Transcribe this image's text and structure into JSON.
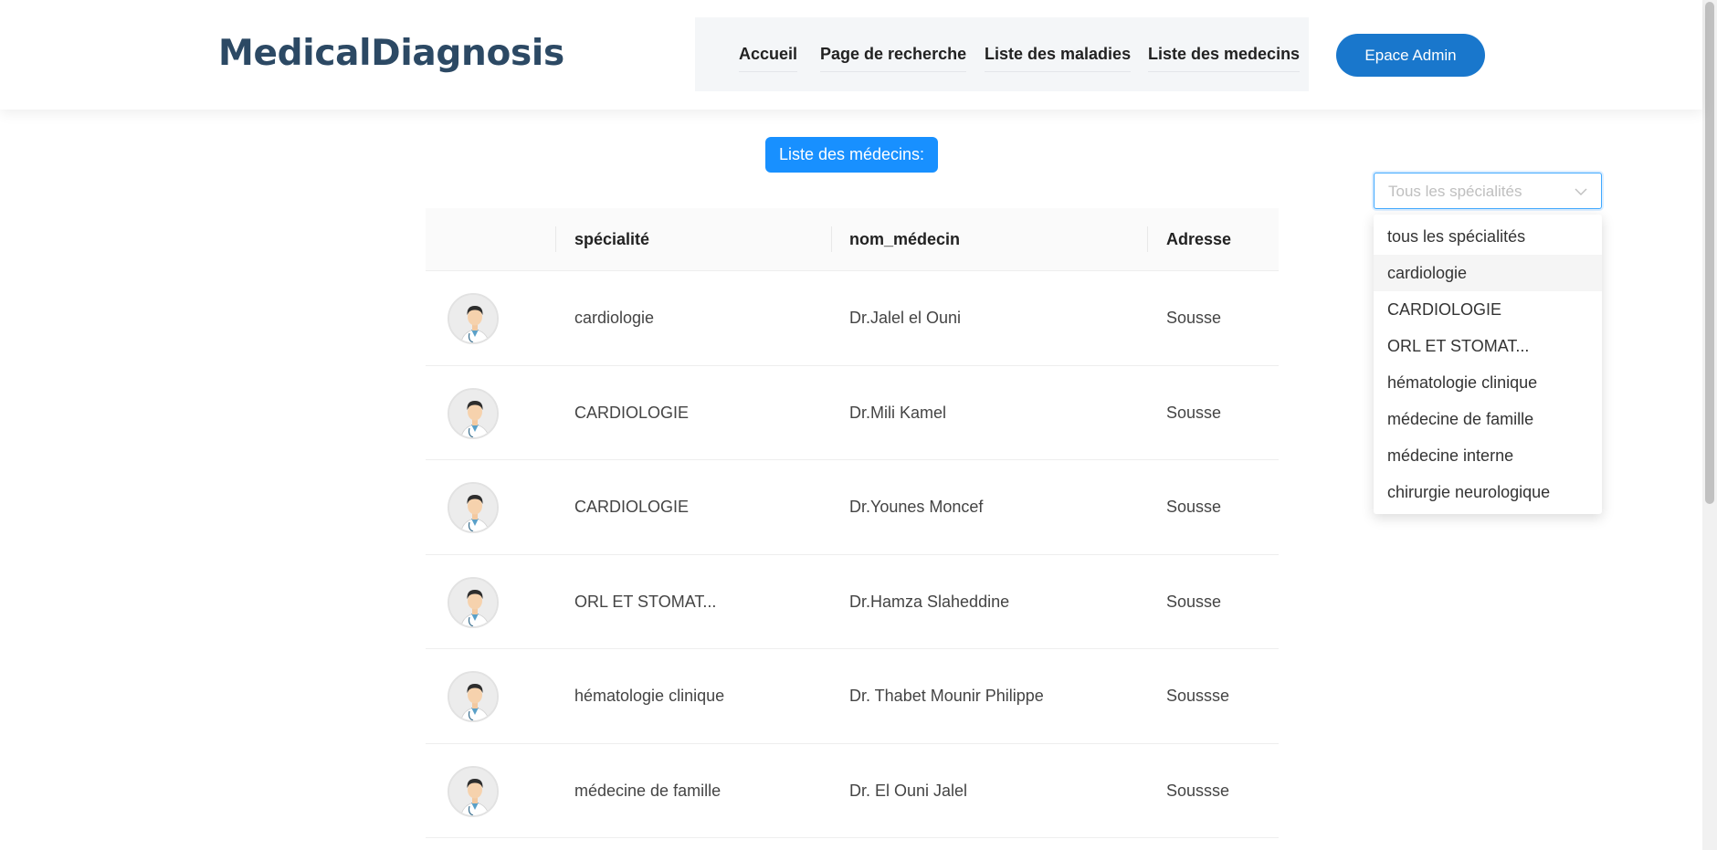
{
  "header": {
    "logo": "MedicalDiagnosis",
    "nav": [
      "Accueil",
      "Page de recherche",
      "Liste des maladies",
      "Liste des medecins"
    ],
    "admin_button": "Epace Admin"
  },
  "page_title": "Liste des médecins:",
  "table": {
    "columns": [
      "spécialité",
      "nom_médecin",
      "Adresse"
    ],
    "rows": [
      {
        "specialite": "cardiologie",
        "nom": "Dr.Jalel el Ouni",
        "adresse": "Sousse"
      },
      {
        "specialite": "CARDIOLOGIE",
        "nom": "Dr.Mili Kamel",
        "adresse": "Sousse"
      },
      {
        "specialite": "CARDIOLOGIE",
        "nom": "Dr.Younes Moncef",
        "adresse": "Sousse"
      },
      {
        "specialite": "ORL ET STOMAT...",
        "nom": "Dr.Hamza Slaheddine",
        "adresse": "Sousse"
      },
      {
        "specialite": "hématologie clinique",
        "nom": "Dr. Thabet Mounir Philippe",
        "adresse": "Soussse"
      },
      {
        "specialite": "médecine de famille",
        "nom": "Dr. El Ouni Jalel",
        "adresse": "Soussse"
      }
    ]
  },
  "filter": {
    "placeholder": "Tous les spécialités",
    "options": [
      "tous les spécialités",
      "cardiologie",
      "CARDIOLOGIE",
      "ORL ET STOMAT...",
      "hématologie clinique",
      "médecine de famille",
      "médecine interne",
      "chirurgie neurologique"
    ],
    "highlighted_option": "cardiologie"
  },
  "icons": {
    "avatar": "doctor-avatar-icon",
    "select": "chevron-down-icon"
  },
  "colors": {
    "brand": "#2c4964",
    "primary": "#1977cc",
    "badge": "#1890ff"
  }
}
